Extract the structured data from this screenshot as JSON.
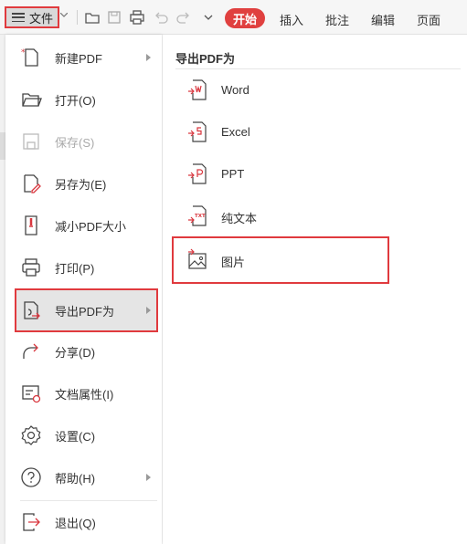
{
  "toolbar": {
    "file_label": "文件",
    "tabs": [
      "开始",
      "插入",
      "批注",
      "编辑",
      "页面"
    ],
    "icons": [
      "open-folder-icon",
      "save-icon",
      "print-icon",
      "undo-icon",
      "redo-icon",
      "dropdown-icon"
    ]
  },
  "menu": {
    "items": [
      {
        "label": "新建PDF",
        "icon": "new-pdf-icon",
        "has_submenu": true
      },
      {
        "label": "打开(O)",
        "icon": "open-icon",
        "has_submenu": false
      },
      {
        "label": "保存(S)",
        "icon": "save-icon",
        "has_submenu": false,
        "disabled": true
      },
      {
        "label": "另存为(E)",
        "icon": "save-as-icon",
        "has_submenu": false
      },
      {
        "label": "减小PDF大小",
        "icon": "compress-icon",
        "has_submenu": false
      },
      {
        "label": "打印(P)",
        "icon": "print-icon",
        "has_submenu": false
      },
      {
        "label": "导出PDF为",
        "icon": "export-icon",
        "has_submenu": true,
        "active": true
      },
      {
        "label": "分享(D)",
        "icon": "share-icon",
        "has_submenu": false
      },
      {
        "label": "文档属性(I)",
        "icon": "properties-icon",
        "has_submenu": false
      },
      {
        "label": "设置(C)",
        "icon": "settings-icon",
        "has_submenu": false
      },
      {
        "label": "帮助(H)",
        "icon": "help-icon",
        "has_submenu": true
      },
      {
        "label": "退出(Q)",
        "icon": "exit-icon",
        "has_submenu": false
      }
    ]
  },
  "submenu": {
    "title": "导出PDF为",
    "items": [
      {
        "label": "Word",
        "icon": "word-icon"
      },
      {
        "label": "Excel",
        "icon": "excel-icon"
      },
      {
        "label": "PPT",
        "icon": "ppt-icon"
      },
      {
        "label": "纯文本",
        "icon": "txt-icon"
      },
      {
        "label": "图片",
        "icon": "image-icon"
      }
    ]
  },
  "colors": {
    "accent": "#e03a3e",
    "tab_active_bg": "#e0403f",
    "icon_red": "#d9363e"
  }
}
